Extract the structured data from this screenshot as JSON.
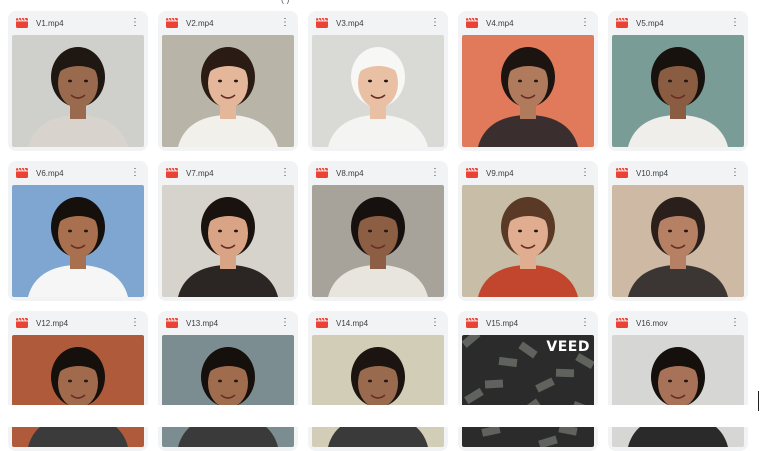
{
  "top_fragment": "(                    )",
  "accent_color": "#ea4335",
  "files": [
    {
      "name": "V1.mp4",
      "bg": "#cfcfcc",
      "skin": "#9a6a4e",
      "hair": "#1e1712",
      "shirt": "#d8d3cd"
    },
    {
      "name": "V2.mp4",
      "bg": "#b9b4a8",
      "skin": "#e4b79a",
      "hair": "#2a1c14",
      "shirt": "#f2f0ea"
    },
    {
      "name": "V3.mp4",
      "bg": "#d9d9d6",
      "skin": "#e9c0a4",
      "hair": "#f7f7f5",
      "shirt": "#f4f4f2"
    },
    {
      "name": "V4.mp4",
      "bg": "#e07a5a",
      "skin": "#b07a5c",
      "hair": "#1c1410",
      "shirt": "#3a2f2e"
    },
    {
      "name": "V5.mp4",
      "bg": "#7a9c96",
      "skin": "#8a5c42",
      "hair": "#18120e",
      "shirt": "#f0eeea"
    },
    {
      "name": "V6.mp4",
      "bg": "#7ea6d0",
      "skin": "#a8704e",
      "hair": "#15100c",
      "shirt": "#f6f6f6"
    },
    {
      "name": "V7.mp4",
      "bg": "#d6d2cc",
      "skin": "#d9a486",
      "hair": "#1a120e",
      "shirt": "#2b2524"
    },
    {
      "name": "V8.mp4",
      "bg": "#a7a29a",
      "skin": "#8c5e44",
      "hair": "#16110e",
      "shirt": "#e8e4de"
    },
    {
      "name": "V9.mp4",
      "bg": "#c8bda6",
      "skin": "#e1ad90",
      "hair": "#5a3a26",
      "shirt": "#c2452e"
    },
    {
      "name": "V10.mp4",
      "bg": "#cdb9a4",
      "skin": "#b58064",
      "hair": "#2a1f1a",
      "shirt": "#3b3634"
    },
    {
      "name": "V12.mp4",
      "bg": "#b05a3c",
      "skin": "#a26a4c",
      "hair": "#15100c",
      "shirt": "#3b3b3b"
    },
    {
      "name": "V13.mp4",
      "bg": "#7c8d92",
      "skin": "#a06c4e",
      "hair": "#15100c",
      "shirt": "#3a3a3a"
    },
    {
      "name": "V14.mp4",
      "bg": "#d2cdb6",
      "skin": "#9a6a4e",
      "hair": "#1c1410",
      "shirt": "#3a3a3a"
    },
    {
      "name": "V15.mp4",
      "bg": "#2b2b2b",
      "logo": "VEED"
    },
    {
      "name": "V16.mov",
      "bg": "#d6d6d4",
      "skin": "#a87258",
      "hair": "#15100c",
      "shirt": "#2a2a2a"
    }
  ]
}
